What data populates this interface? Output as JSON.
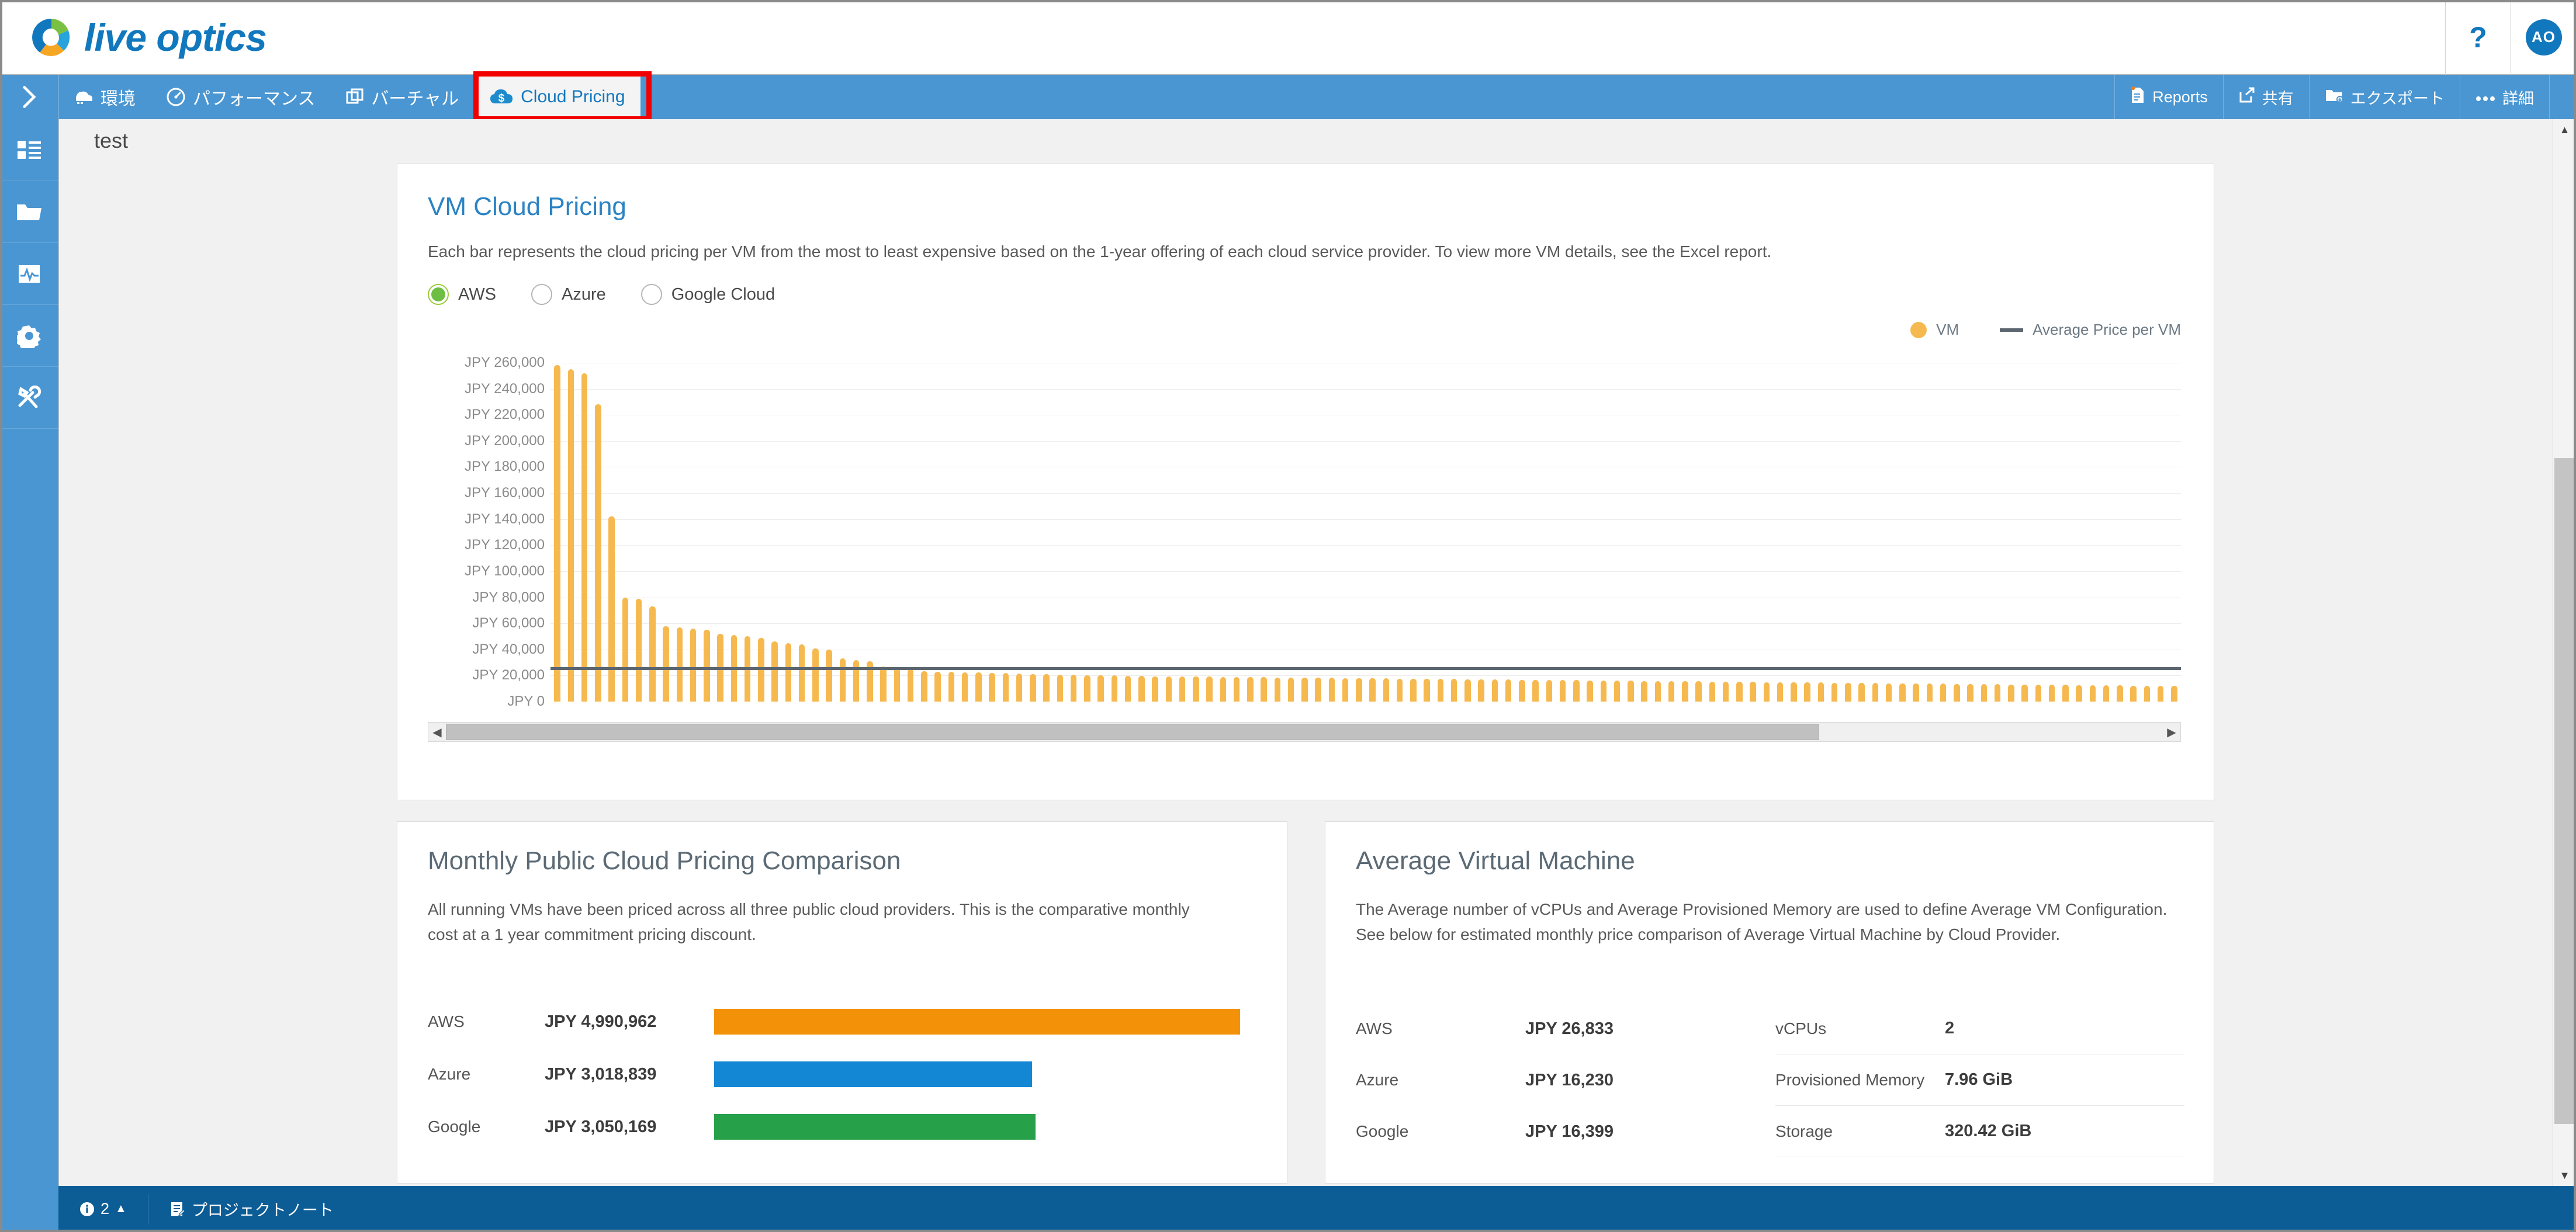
{
  "header": {
    "logo_text": "live optics",
    "help_icon": "question-mark-icon",
    "avatar_initials": "AO"
  },
  "nav": {
    "expand_icon": "chevron-right-icon",
    "tabs": [
      {
        "label": "環境",
        "icon": "server-icon",
        "active": false
      },
      {
        "label": "パフォーマンス",
        "icon": "gauge-icon",
        "active": false
      },
      {
        "label": "バーチャル",
        "icon": "virtual-stack-icon",
        "active": false
      },
      {
        "label": "Cloud Pricing",
        "icon": "cloud-dollar-icon",
        "active": true
      }
    ],
    "actions": [
      {
        "label": "Reports",
        "icon": "report-doc-icon"
      },
      {
        "label": "共有",
        "icon": "share-icon"
      },
      {
        "label": "エクスポート",
        "icon": "export-folder-icon"
      },
      {
        "label": "詳細",
        "icon": "ellipsis-icon"
      }
    ]
  },
  "sidebar": {
    "items": [
      {
        "name": "dashboard-icon"
      },
      {
        "name": "projects-folder-icon"
      },
      {
        "name": "activity-monitor-icon"
      },
      {
        "name": "settings-gear-icon"
      },
      {
        "name": "tools-icon"
      }
    ]
  },
  "project": {
    "title": "test"
  },
  "vm_card": {
    "title": "VM Cloud Pricing",
    "description": "Each bar represents the cloud pricing per VM from the most to least expensive based on the 1-year offering of each cloud service provider. To view more VM details, see the Excel report.",
    "providers": [
      {
        "label": "AWS",
        "selected": true
      },
      {
        "label": "Azure",
        "selected": false
      },
      {
        "label": "Google Cloud",
        "selected": false
      }
    ],
    "legend": [
      {
        "label": "VM",
        "type": "dot",
        "color": "#f6b94f"
      },
      {
        "label": "Average Price per VM",
        "type": "line",
        "color": "#5c6670"
      }
    ],
    "scroll": {
      "left_arrow": "◀",
      "right_arrow": "▶",
      "thumb_percent": 80
    }
  },
  "monthly_card": {
    "title": "Monthly Public Cloud Pricing Comparison",
    "description": "All running VMs have been priced across all three public cloud providers. This is the comparative monthly cost at a 1 year commitment pricing discount.",
    "rows": [
      {
        "name": "AWS",
        "value": "JPY 4,990,962",
        "amount": 4990962,
        "color": "#f39208"
      },
      {
        "name": "Azure",
        "value": "JPY 3,018,839",
        "amount": 3018839,
        "color": "#1487d4"
      },
      {
        "name": "Google",
        "value": "JPY 3,050,169",
        "amount": 3050169,
        "color": "#27a04a"
      }
    ]
  },
  "avg_vm_card": {
    "title": "Average Virtual Machine",
    "description": "The Average number of vCPUs and Average Provisioned Memory are used to define Average VM Configuration. See below for estimated monthly price comparison of Average Virtual Machine by Cloud Provider.",
    "prices": [
      {
        "name": "AWS",
        "value": "JPY 26,833"
      },
      {
        "name": "Azure",
        "value": "JPY 16,230"
      },
      {
        "name": "Google",
        "value": "JPY 16,399"
      }
    ],
    "specs": [
      {
        "name": "vCPUs",
        "value": "2"
      },
      {
        "name": "Provisioned Memory",
        "value": "7.96 GiB"
      },
      {
        "name": "Storage",
        "value": "320.42 GiB"
      }
    ]
  },
  "status_bar": {
    "info_icon": "info-circle-icon",
    "info_count": "2",
    "info_caret": "▲",
    "notes_icon": "note-icon",
    "notes_label": "プロジェクトノート"
  },
  "chart_data": {
    "type": "bar",
    "title": "VM Cloud Pricing",
    "xlabel": "",
    "ylabel": "JPY",
    "ylim": [
      0,
      260000
    ],
    "ytick_step": 20000,
    "ytick_labels": [
      "JPY 260,000",
      "JPY 240,000",
      "JPY 220,000",
      "JPY 200,000",
      "JPY 180,000",
      "JPY 160,000",
      "JPY 140,000",
      "JPY 120,000",
      "JPY 100,000",
      "JPY 80,000",
      "JPY 60,000",
      "JPY 40,000",
      "JPY 20,000",
      "JPY 0"
    ],
    "grid": true,
    "legend_position": "top-right",
    "series": [
      {
        "name": "VM",
        "color": "#f6b94f",
        "values": [
          258000,
          255000,
          252000,
          228000,
          142000,
          80000,
          79000,
          73000,
          58000,
          57000,
          56000,
          55000,
          52000,
          51000,
          50000,
          49000,
          46000,
          45000,
          44000,
          41000,
          40000,
          33000,
          32000,
          31000,
          27000,
          26000,
          25000,
          23500,
          23000,
          22800,
          22500,
          22200,
          22000,
          21800,
          21500,
          21300,
          21000,
          20800,
          20600,
          20400,
          20200,
          20000,
          19800,
          19600,
          19500,
          19400,
          19300,
          19200,
          19100,
          19000,
          18900,
          18800,
          18700,
          18600,
          18500,
          18400,
          18300,
          18200,
          18100,
          18000,
          17900,
          17800,
          17700,
          17600,
          17500,
          17400,
          17300,
          17200,
          17100,
          17000,
          16900,
          16800,
          16700,
          16600,
          16500,
          16400,
          16300,
          16200,
          16100,
          16000,
          15900,
          15800,
          15700,
          15600,
          15500,
          15400,
          15300,
          15200,
          15100,
          15000,
          14900,
          14800,
          14700,
          14600,
          14500,
          14400,
          14300,
          14200,
          14100,
          14000,
          13900,
          13800,
          13700,
          13600,
          13500,
          13400,
          13300,
          13200,
          13100,
          13000,
          12900,
          12800,
          12700,
          12600,
          12500,
          12400,
          12300,
          12200,
          12100,
          12000
        ]
      },
      {
        "name": "Average Price per VM",
        "type": "hline",
        "color": "#5c6670",
        "value": 24000
      }
    ]
  }
}
